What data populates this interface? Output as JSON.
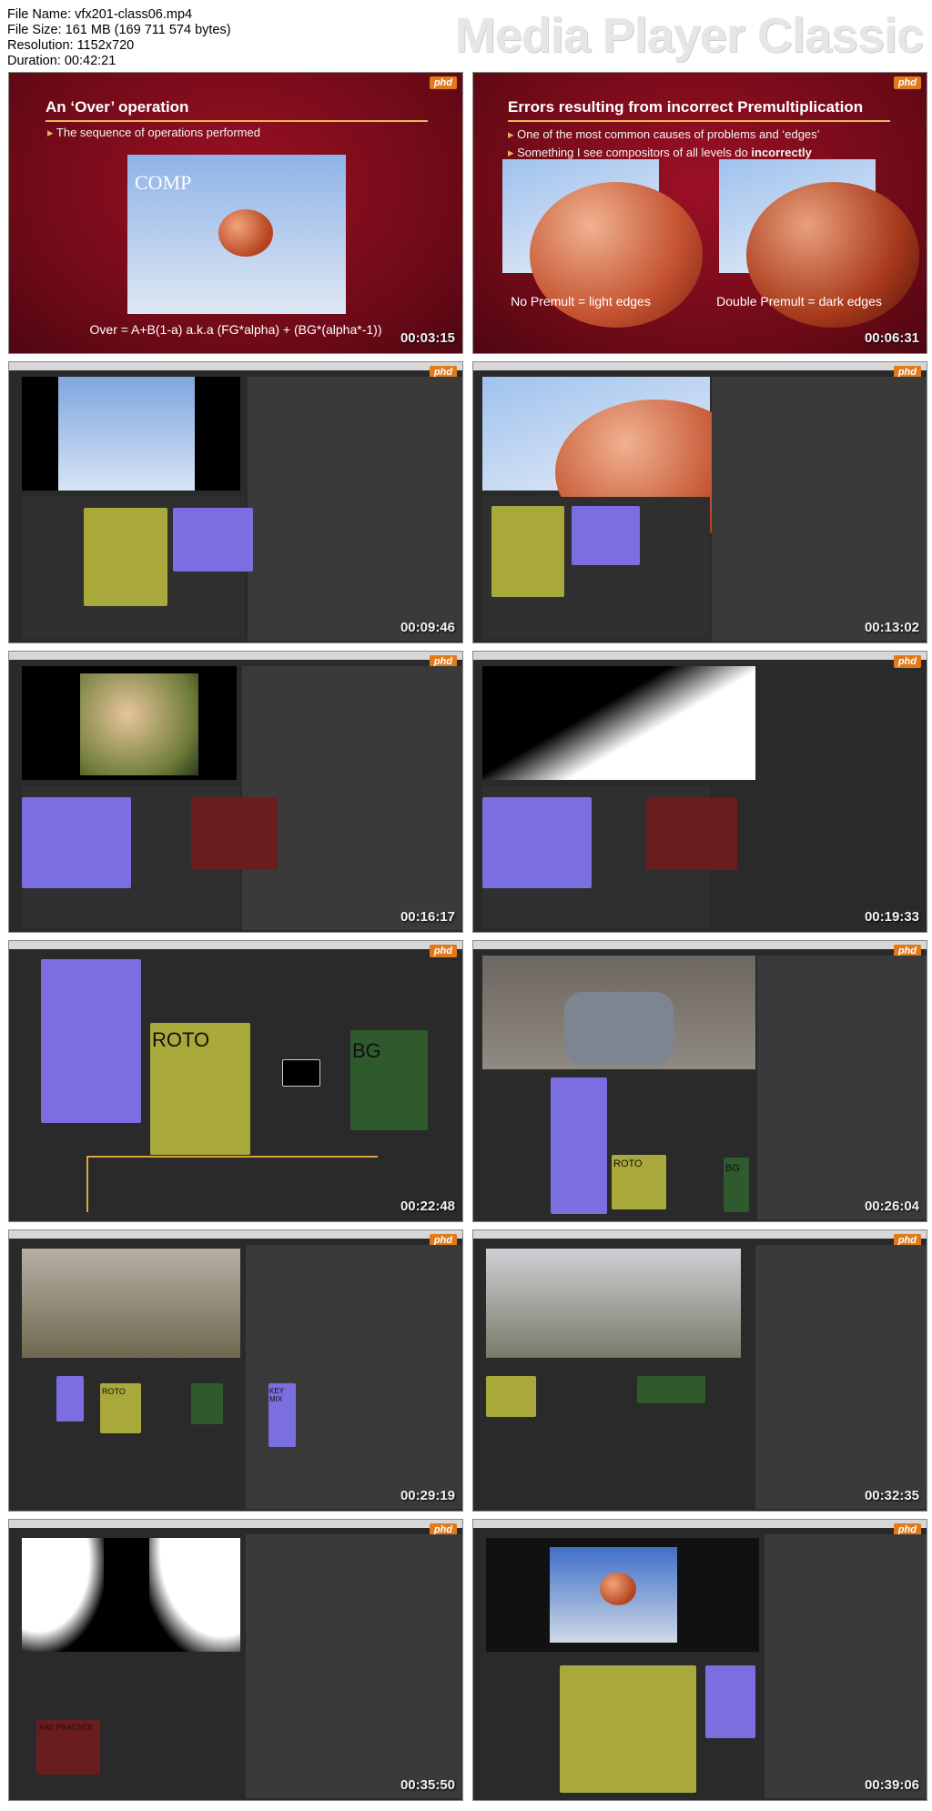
{
  "header": {
    "file_name": "File Name: vfx201-class06.mp4",
    "file_size": "File Size: 161 MB (169 711 574 bytes)",
    "resolution": "Resolution: 1152x720",
    "duration": "Duration: 00:42:21",
    "brand": "Media Player Classic"
  },
  "logo": "phd",
  "thumbs": [
    {
      "ts": "00:03:15"
    },
    {
      "ts": "00:06:31"
    },
    {
      "ts": "00:09:46"
    },
    {
      "ts": "00:13:02"
    },
    {
      "ts": "00:16:17"
    },
    {
      "ts": "00:19:33"
    },
    {
      "ts": "00:22:48"
    },
    {
      "ts": "00:26:04"
    },
    {
      "ts": "00:29:19"
    },
    {
      "ts": "00:32:35"
    },
    {
      "ts": "00:35:50"
    },
    {
      "ts": "00:39:06"
    }
  ],
  "slide1": {
    "title": "An ‘Over’ operation",
    "bullet": "The sequence of operations performed",
    "image_label": "COMP",
    "formula": "Over = A+B(1-a) a.k.a (FG*alpha) + (BG*(alpha*-1))"
  },
  "slide2": {
    "title": "Errors resulting from incorrect Premultiplication",
    "bullet1": "One of the most common causes of problems and ‘edges’",
    "bullet2_pre": "Something I see compositors of all levels do ",
    "bullet2_bold": "incorrectly",
    "cap_left": "No Premult = light edges",
    "cap_right": "Double Premult = dark edges"
  },
  "labels": {
    "roto": "ROTO",
    "bg": "BG",
    "roto_small": "ROTO",
    "bg_small": "BG",
    "key_mix": "KEY MIX",
    "bad_practice": "BAD PRACTICE"
  },
  "colors": {
    "slide_red": "#8a0e1f",
    "accent_gold": "#e3b45c",
    "node_purple": "#7b6ee0",
    "node_yellow": "#a8a93a",
    "node_red": "#6a1d1f",
    "node_green": "#2e5a2e"
  }
}
